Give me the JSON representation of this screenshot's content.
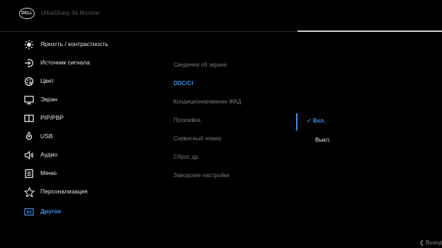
{
  "header": {
    "logo_text": "DELL",
    "model": "UltraSharp 34 Monitor"
  },
  "menu": [
    {
      "label": "Яркость / контрастность",
      "icon": "brightness-icon",
      "active": false
    },
    {
      "label": "Источник сигнала",
      "icon": "input-source-icon",
      "active": false
    },
    {
      "label": "Цвет",
      "icon": "color-palette-icon",
      "active": false
    },
    {
      "label": "Экран",
      "icon": "display-icon",
      "active": false
    },
    {
      "label": "PIP/PBP",
      "icon": "pip-pbp-icon",
      "active": false
    },
    {
      "label": "USB",
      "icon": "usb-icon",
      "active": false
    },
    {
      "label": "Аудио",
      "icon": "audio-icon",
      "active": false
    },
    {
      "label": "Меню",
      "icon": "menu-icon",
      "active": false
    },
    {
      "label": "Персонализация",
      "icon": "star-icon",
      "active": false
    },
    {
      "label": "Другое",
      "icon": "other-icon",
      "active": true
    }
  ],
  "submenu": [
    {
      "label": "Сведения об экране",
      "active": false
    },
    {
      "label": "DDC/CI",
      "active": true
    },
    {
      "label": "Кондиционирование ЖКД",
      "active": false
    },
    {
      "label": "Прошивка",
      "active": false
    },
    {
      "label": "Сервисный номер",
      "active": false
    },
    {
      "label": "Сброс др.",
      "active": false
    },
    {
      "label": "Заводские настройки",
      "active": false
    }
  ],
  "options": {
    "on": "✓ Вкл.",
    "off": "Выкл."
  },
  "footer": {
    "exit": "❮ Выход"
  },
  "colors": {
    "accent": "#3f8fe6",
    "background": "#000000",
    "text": "#e6e6e6",
    "dim": "#7a7a7a"
  }
}
